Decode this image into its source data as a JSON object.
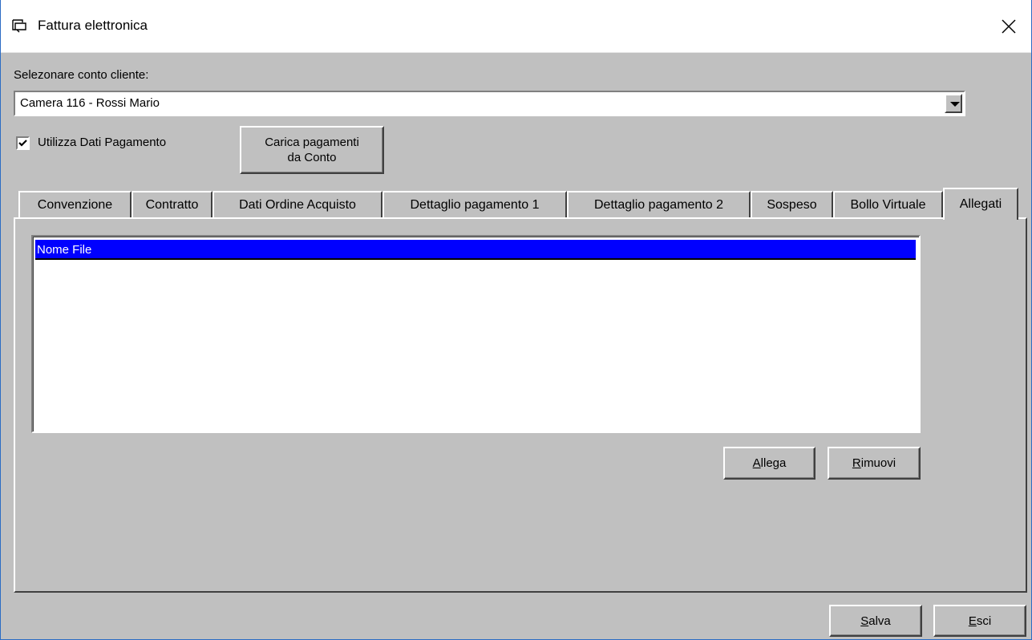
{
  "window": {
    "title": "Fattura elettronica"
  },
  "form": {
    "client_label": "Selezonare conto cliente:",
    "client_value": "Camera 116 - Rossi Mario",
    "use_payment_label": "Utilizza Dati Pagamento",
    "use_payment_checked": true,
    "load_payments_line1": "Carica pagamenti",
    "load_payments_line2": "da Conto"
  },
  "tabs": [
    {
      "label": "Convenzione"
    },
    {
      "label": "Contratto"
    },
    {
      "label": "Dati Ordine Acquisto"
    },
    {
      "label": "Dettaglio pagamento 1"
    },
    {
      "label": "Dettaglio pagamento 2"
    },
    {
      "label": "Sospeso"
    },
    {
      "label": "Bollo Virtuale"
    },
    {
      "label": "Allegati",
      "active": true
    }
  ],
  "attachments": {
    "column_header": "Nome File",
    "rows": [],
    "attach_label_mn": "A",
    "attach_label_rest": "llega",
    "remove_label_mn": "R",
    "remove_label_rest": "imuovi"
  },
  "footer": {
    "save_mn": "S",
    "save_rest": "alva",
    "exit_mn": "E",
    "exit_rest": "sci"
  },
  "colors": {
    "face": "#c0c0c0",
    "selection": "#0000ff",
    "window_border": "#2b6cc4"
  },
  "icons": {
    "app": "window-icon",
    "close": "close-icon",
    "dropdown": "chevron-down-icon",
    "check": "checkmark-icon"
  }
}
